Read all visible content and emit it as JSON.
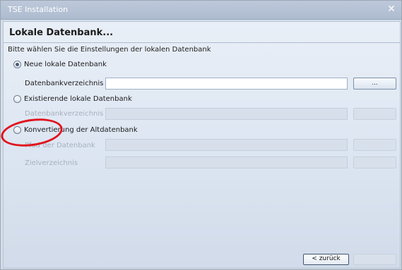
{
  "window": {
    "title": "TSE Installation",
    "close_glyph": "✕"
  },
  "page": {
    "heading": "Lokale Datenbank...",
    "subtitle": "Bitte wählen Sie die Einstellungen der lokalen Datenbank"
  },
  "options": [
    {
      "label": "Neue lokale Datenbank",
      "selected": true
    },
    {
      "label": "Existierende lokale Datenbank",
      "selected": false
    },
    {
      "label": "Konvertierung der Altdatenbank",
      "selected": false
    }
  ],
  "fields": {
    "new_db_dir_label": "Datenbankverzeichnis",
    "existing_db_dir_label": "Datenbankverzeichnis",
    "old_db_path_label": "Pfad der Datenbank",
    "target_dir_label": "Zielverzeichnis",
    "browse_label": "...",
    "new_db_dir_value": "",
    "existing_db_dir_value": "",
    "old_db_path_value": "",
    "target_dir_value": ""
  },
  "footer": {
    "back_label": "< zurück",
    "next_label": ""
  },
  "annotation": {
    "color": "#e1141d",
    "shape": "red-circle"
  }
}
